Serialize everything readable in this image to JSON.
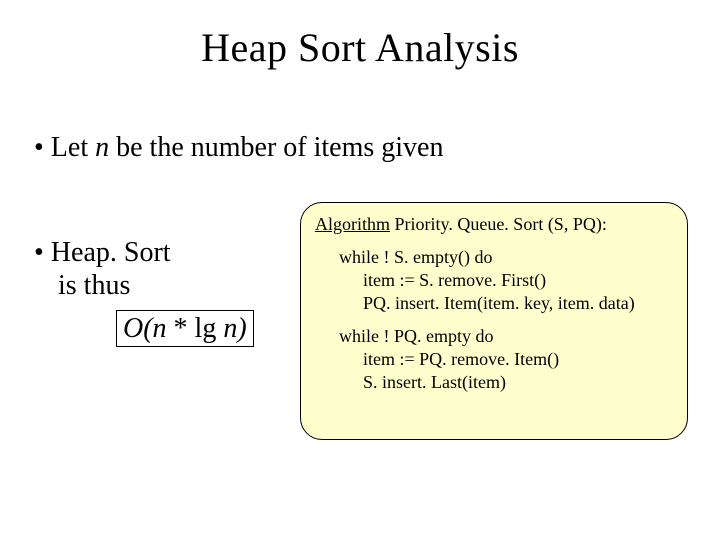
{
  "title": "Heap Sort Analysis",
  "bullet1_pre": "• Let ",
  "bullet1_n": "n",
  "bullet1_post": " be the number of items given",
  "bullet2_line1": "• Heap. Sort",
  "bullet2_line2": "is thus",
  "complexity_pre": "O(n",
  "complexity_mid": " * lg ",
  "complexity_post": "n)",
  "algo_kw": "Algorithm",
  "algo_sig": " Priority. Queue. Sort (S, PQ):",
  "algo_l1": "while ! S. empty() do",
  "algo_l2": "item := S. remove. First()",
  "algo_l3": "PQ. insert. Item(item. key, item. data)",
  "algo_l4": "while ! PQ. empty do",
  "algo_l5": "item := PQ. remove. Item()",
  "algo_l6": "S. insert. Last(item)"
}
